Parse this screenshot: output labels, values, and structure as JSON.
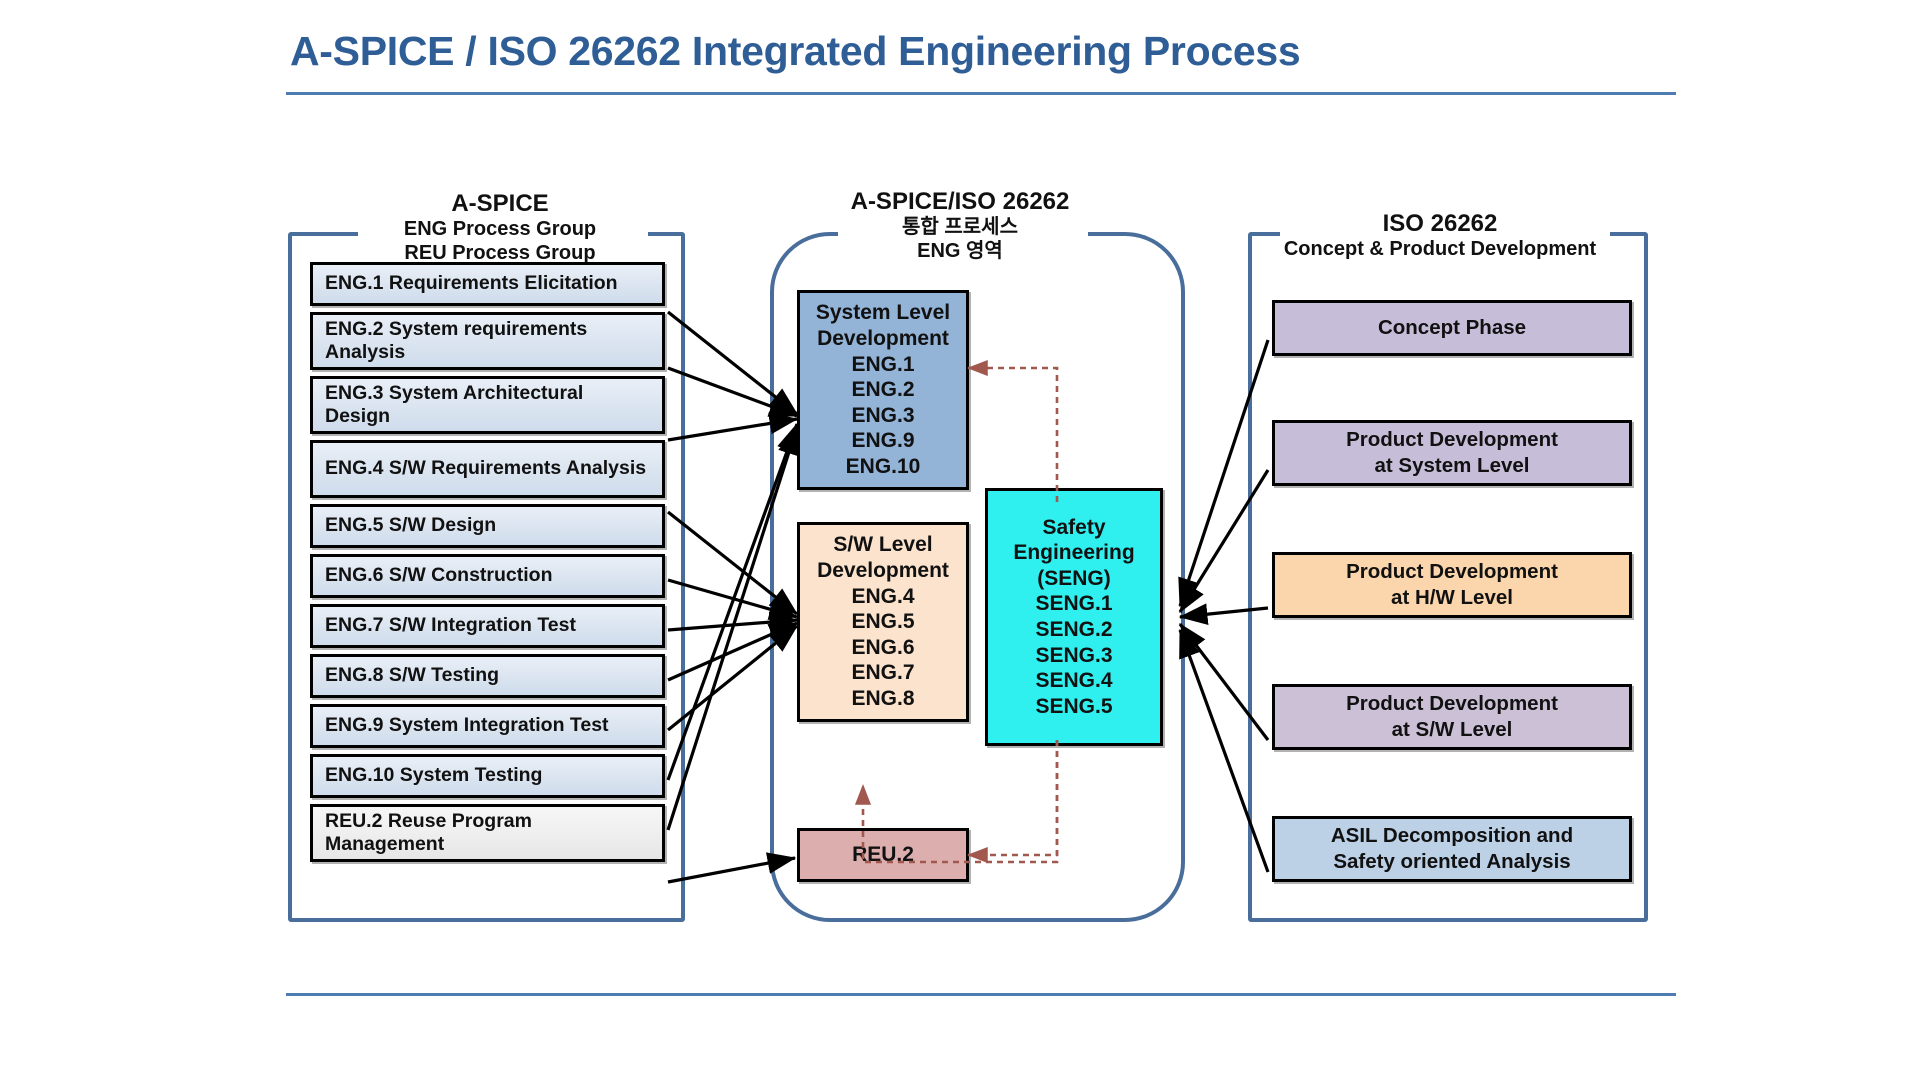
{
  "title": "A-SPICE  / ISO 26262 Integrated Engineering Process",
  "columns": {
    "left": {
      "heading_main": "A-SPICE",
      "heading_sub1": "ENG Process Group",
      "heading_sub2": "REU Process Group",
      "items": [
        {
          "label": "ENG.1 Requirements Elicitation",
          "style": "blue"
        },
        {
          "label": "ENG.2 System requirements Analysis",
          "style": "blue"
        },
        {
          "label": "ENG.3 System Architectural Design",
          "style": "blue"
        },
        {
          "label": "ENG.4 S/W Requirements Analysis",
          "style": "blue"
        },
        {
          "label": "ENG.5 S/W Design",
          "style": "blue"
        },
        {
          "label": "ENG.6 S/W Construction",
          "style": "blue"
        },
        {
          "label": "ENG.7 S/W Integration Test",
          "style": "blue"
        },
        {
          "label": "ENG.8 S/W Testing",
          "style": "blue"
        },
        {
          "label": "ENG.9 System Integration Test",
          "style": "blue"
        },
        {
          "label": "ENG.10 System Testing",
          "style": "blue"
        },
        {
          "label": "REU.2 Reuse Program Management",
          "style": "neutral"
        }
      ]
    },
    "center": {
      "heading_main": "A-SPICE/ISO 26262",
      "heading_sub1": "통합 프로세스",
      "heading_sub2": "ENG 영역",
      "boxes": [
        {
          "name": "system-level-development",
          "lines": [
            "System Level",
            "Development",
            "ENG.1",
            "ENG.2",
            "ENG.3",
            "ENG.9",
            "ENG.10"
          ],
          "color": "#93b3d7"
        },
        {
          "name": "sw-level-development",
          "lines": [
            "S/W Level",
            "Development",
            "ENG.4",
            "ENG.5",
            "ENG.6",
            "ENG.7",
            "ENG.8"
          ],
          "color": "#fce3cd"
        },
        {
          "name": "safety-engineering",
          "lines": [
            "Safety",
            "Engineering",
            "(SENG)",
            "SENG.1",
            "SENG.2",
            "SENG.3",
            "SENG.4",
            "SENG.5"
          ],
          "color": "#2ff0ef"
        },
        {
          "name": "reu2",
          "lines": [
            "REU.2"
          ],
          "color": "#ddaeae"
        }
      ]
    },
    "right": {
      "heading_main": "ISO 26262",
      "heading_sub1": "Concept  &  Product  Development",
      "items": [
        {
          "lines": [
            "Concept Phase"
          ],
          "color": "#c6bed9"
        },
        {
          "lines": [
            "Product Development",
            "at System Level"
          ],
          "color": "#c6bed9"
        },
        {
          "lines": [
            "Product Development",
            "at H/W Level"
          ],
          "color": "#fbd5ab"
        },
        {
          "lines": [
            "Product Development",
            "at S/W Level"
          ],
          "color": "#ccc0d7"
        },
        {
          "lines": [
            "ASIL Decomposition and",
            "Safety oriented Analysis"
          ],
          "color": "#bcd0e6"
        }
      ]
    }
  },
  "colors": {
    "title": "#2f5d96",
    "container_border": "#4a6e9b",
    "solid_arrow": "#000000",
    "dashed_arrow": "#a0584f"
  }
}
